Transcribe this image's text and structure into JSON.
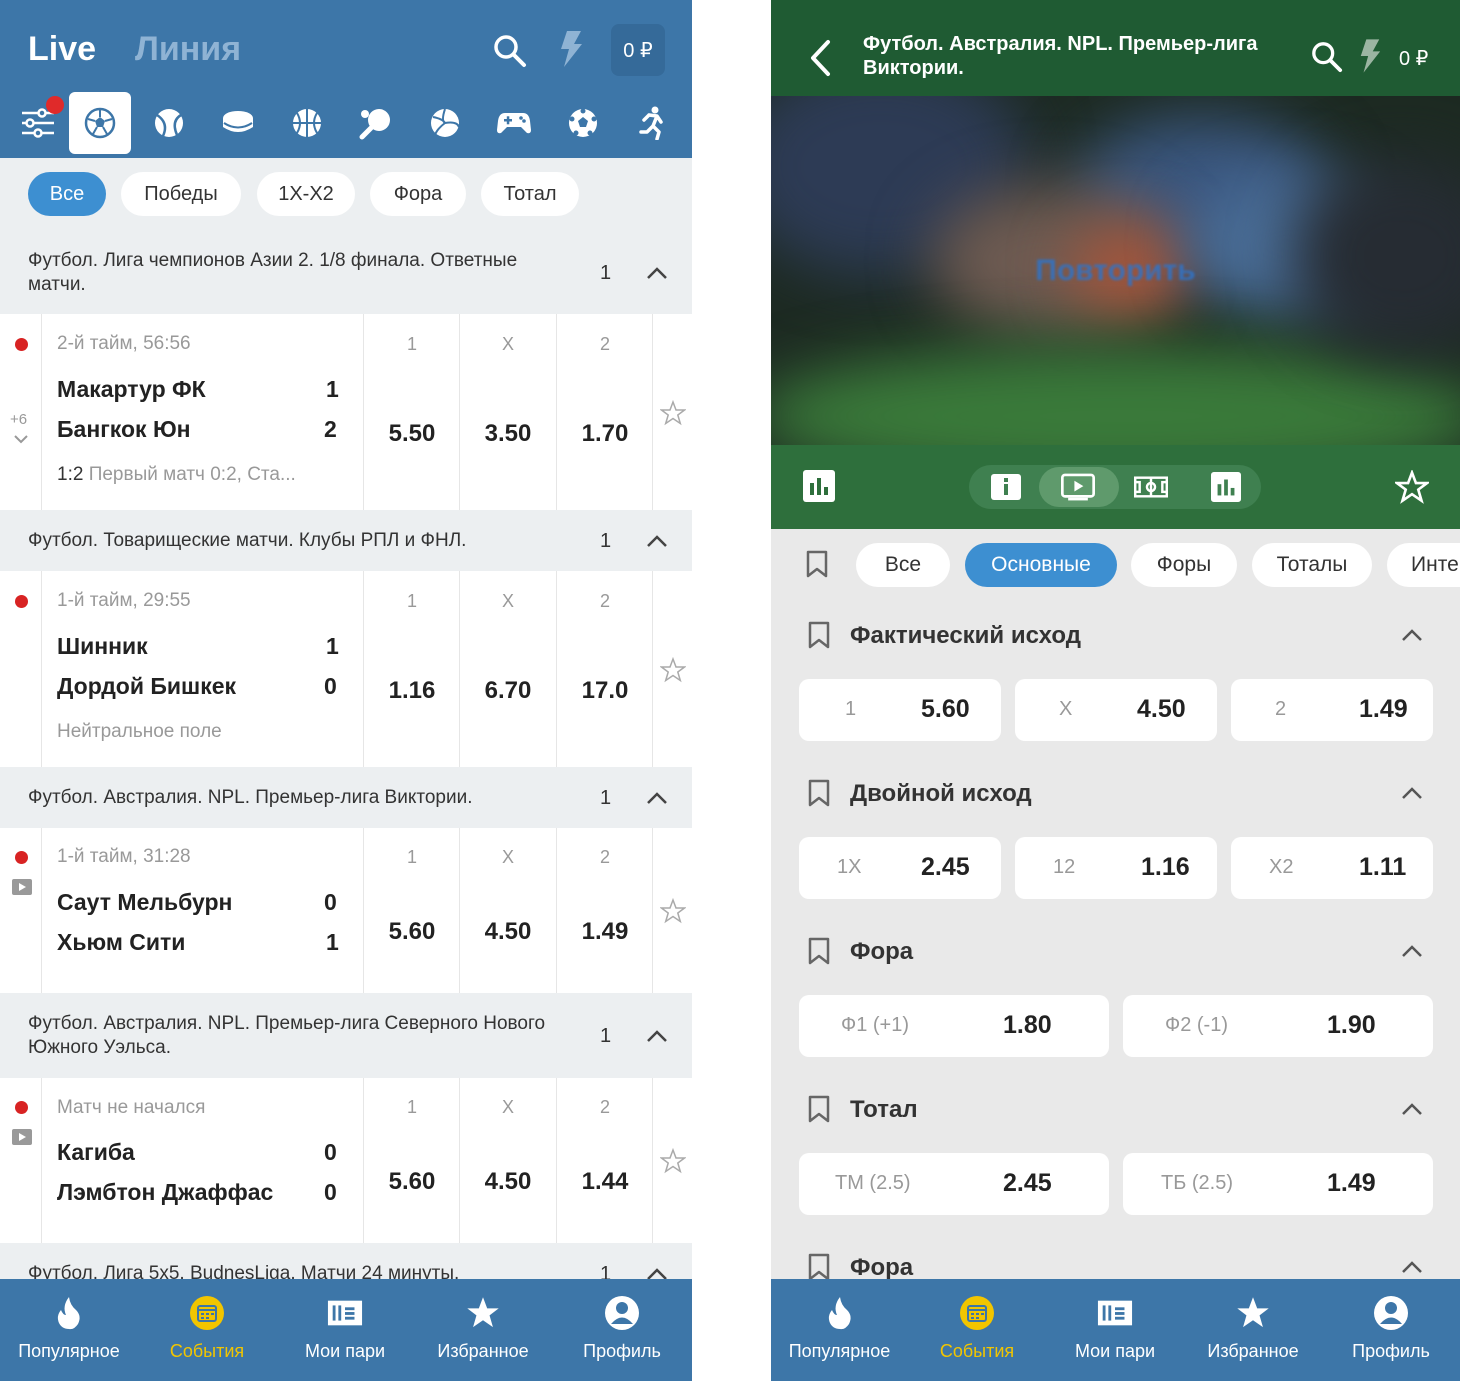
{
  "left": {
    "tabs": {
      "live": "Live",
      "line": "Линия"
    },
    "balance": "0 ₽",
    "sports": [
      "filters-icon",
      "football-icon",
      "tennis-icon",
      "hockey-icon",
      "basketball-icon",
      "table-tennis-icon",
      "volleyball-icon",
      "esports-icon",
      "futsal-icon",
      "athletics-icon"
    ],
    "chips": [
      "Все",
      "Победы",
      "1X-X2",
      "Фора",
      "Тотал"
    ],
    "leagues": [
      {
        "title": "Футбол. Лига чемпионов Азии 2. 1/8 финала. Ответные матчи.",
        "count": "1",
        "match": {
          "status": "2-й тайм, 56:56",
          "team1": "Макартур ФК",
          "score1": "1",
          "team2": "Бангкок Юн",
          "score2": "2",
          "note_score": "1:2",
          "note": "Первый матч 0:2, Ста...",
          "extra": "+6",
          "labels": [
            "1",
            "X",
            "2"
          ],
          "odds": [
            "5.50",
            "3.50",
            "1.70"
          ]
        }
      },
      {
        "title": "Футбол. Товарищеские матчи. Клубы РПЛ и ФНЛ.",
        "count": "1",
        "match": {
          "status": "1-й тайм, 29:55",
          "team1": "Шинник",
          "score1": "1",
          "team2": "Дордой Бишкек",
          "score2": "0",
          "note": "Нейтральное поле",
          "labels": [
            "1",
            "X",
            "2"
          ],
          "odds": [
            "1.16",
            "6.70",
            "17.0"
          ]
        }
      },
      {
        "title": "Футбол. Австралия. NPL. Премьер-лига Виктории.",
        "count": "1",
        "match": {
          "status": "1-й тайм, 31:28",
          "team1": "Саут Мельбурн",
          "score1": "0",
          "team2": "Хьюм Сити",
          "score2": "1",
          "labels": [
            "1",
            "X",
            "2"
          ],
          "odds": [
            "5.60",
            "4.50",
            "1.49"
          ]
        }
      },
      {
        "title": "Футбол. Австралия. NPL. Премьер-лига Северного Нового Южного Уэльса.",
        "count": "1",
        "match": {
          "status": "Матч не начался",
          "team1": "Кагиба",
          "score1": "0",
          "team2": "Лэмбтон Джаффас",
          "score2": "0",
          "labels": [
            "1",
            "X",
            "2"
          ],
          "odds": [
            "5.60",
            "4.50",
            "1.44"
          ]
        }
      },
      {
        "title": "Футбол. Лига 5х5. BudnesLiga. Матчи 24 минуты.",
        "count": "1"
      }
    ]
  },
  "right": {
    "title": "Футбол. Австралия. NPL. Премьер-лига Виктории.",
    "balance": "0 ₽",
    "video_overlay": "Повторить",
    "chips": [
      "Все",
      "Основные",
      "Форы",
      "Тоталы",
      "Инте"
    ],
    "sections": [
      {
        "title": "Фактический исход",
        "outcomes": [
          {
            "label": "1",
            "odd": "5.60"
          },
          {
            "label": "X",
            "odd": "4.50"
          },
          {
            "label": "2",
            "odd": "1.49"
          }
        ]
      },
      {
        "title": "Двойной исход",
        "outcomes": [
          {
            "label": "1X",
            "odd": "2.45"
          },
          {
            "label": "12",
            "odd": "1.16"
          },
          {
            "label": "X2",
            "odd": "1.11"
          }
        ]
      },
      {
        "title": "Фора",
        "outcomes": [
          {
            "label": "Ф1 (+1)",
            "odd": "1.80"
          },
          {
            "label": "Ф2 (-1)",
            "odd": "1.90"
          }
        ]
      },
      {
        "title": "Тотал",
        "outcomes": [
          {
            "label": "ТМ (2.5)",
            "odd": "2.45"
          },
          {
            "label": "ТБ (2.5)",
            "odd": "1.49"
          }
        ]
      },
      {
        "title": "Фора"
      }
    ]
  },
  "nav": [
    "Популярное",
    "События",
    "Мои пари",
    "Избранное",
    "Профиль"
  ],
  "colors": {
    "left_header": "#3d76a8",
    "right_header": "#1f5b33",
    "accent_blue": "#3d8fd1",
    "active_nav": "#f2c500",
    "live_dot": "#d82323"
  }
}
